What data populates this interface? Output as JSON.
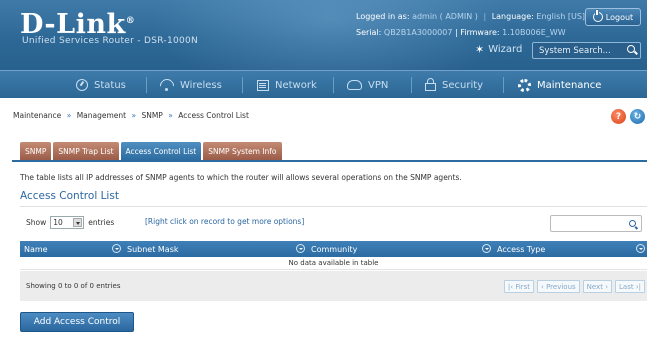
{
  "header": {
    "logo": "D-Link",
    "logo_mark": "®",
    "subtitle": "Unified Services Router - DSR-1000N",
    "logged_in_label": "Logged in as:",
    "logged_in_value": "admin ( ADMIN )",
    "language_label": "Language:",
    "language_value": "English [US]",
    "serial_label": "Serial:",
    "serial_value": "QB2B1A3000007",
    "firmware_label": "Firmware:",
    "firmware_value": "1.10B006E_WW",
    "logout_label": "Logout",
    "wizard_label": "Wizard",
    "search_placeholder": "System Search..."
  },
  "nav": {
    "items": [
      {
        "label": "Status",
        "icon": "status-icon"
      },
      {
        "label": "Wireless",
        "icon": "wifi-icon"
      },
      {
        "label": "Network",
        "icon": "network-icon"
      },
      {
        "label": "VPN",
        "icon": "vpn-icon"
      },
      {
        "label": "Security",
        "icon": "lock-icon"
      },
      {
        "label": "Maintenance",
        "icon": "gear-icon",
        "active": true
      }
    ]
  },
  "breadcrumb": [
    "Maintenance",
    "Management",
    "SNMP",
    "Access Control List"
  ],
  "breadcrumb_sep": "»",
  "tabs": [
    {
      "label": "SNMP"
    },
    {
      "label": "SNMP Trap List"
    },
    {
      "label": "Access Control List",
      "active": true
    },
    {
      "label": "SNMP System Info"
    }
  ],
  "description": "The table lists all IP addresses of SNMP agents to which the router will allows several operations on the SNMP agents.",
  "section_title": "Access Control List",
  "table": {
    "show_label": "Show",
    "show_value": "10",
    "entries_label": "entries",
    "hint": "[Right click on record to get more options]",
    "columns": [
      "Name",
      "Subnet Mask",
      "Community",
      "Access Type"
    ],
    "empty_message": "No data available in table",
    "info": "Showing 0 to 0 of 0 entries",
    "pager": {
      "first": "First",
      "previous": "Previous",
      "next": "Next",
      "last": "Last"
    }
  },
  "add_button": "Add Access Control",
  "colors": {
    "header_blue": "#2d6896",
    "accent_blue": "#2b67a0",
    "tab_inactive": "#9a5c48",
    "help_orange": "#d9421b"
  }
}
